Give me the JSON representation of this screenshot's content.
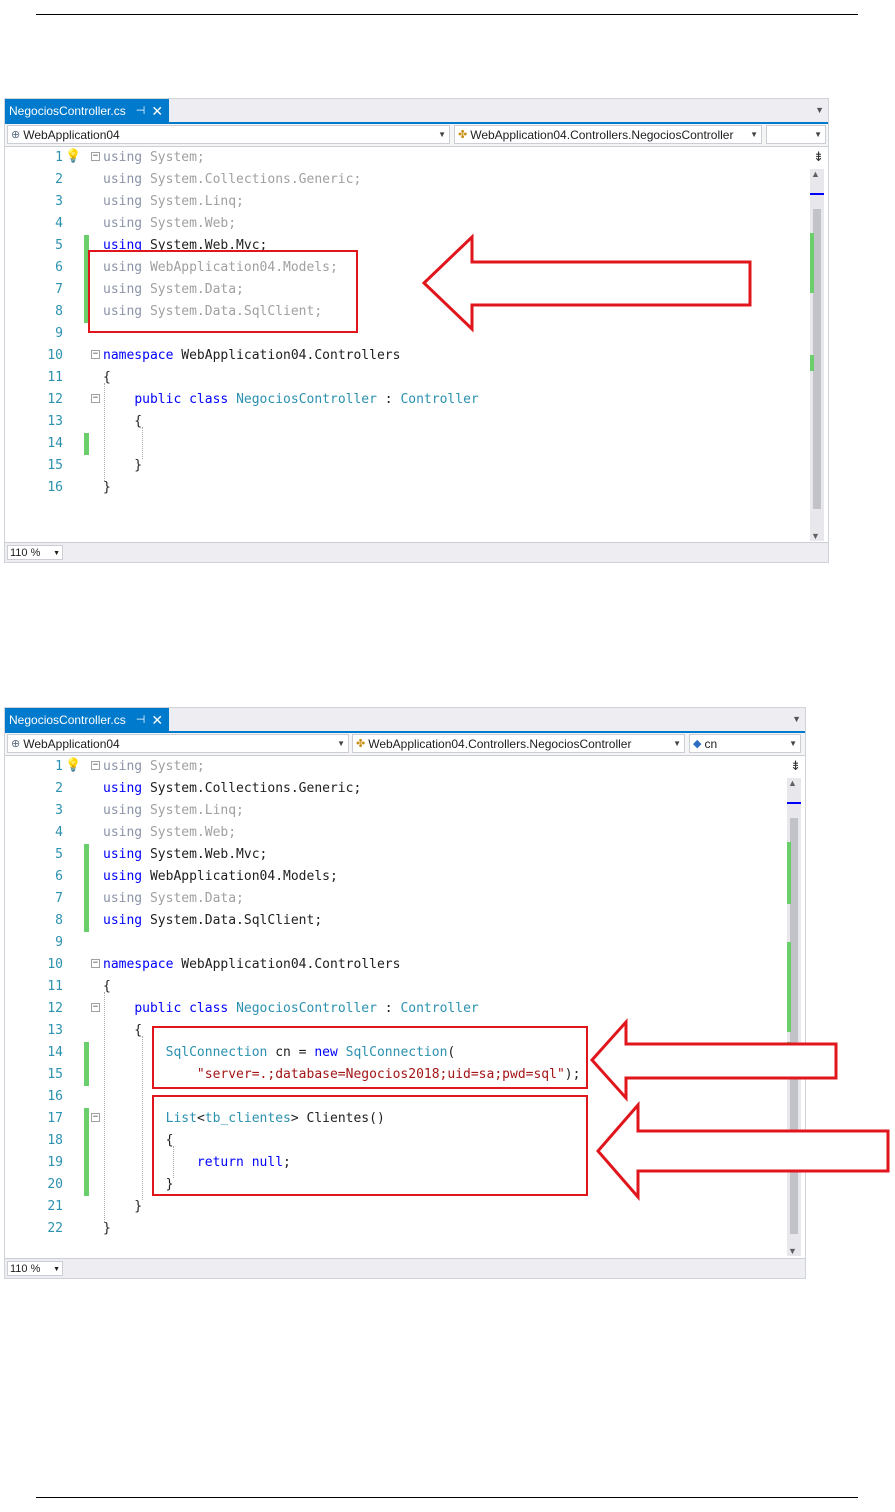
{
  "editor1": {
    "tab": {
      "filename": "NegociosController.cs",
      "pin": "⊣",
      "close": "✕"
    },
    "nav": {
      "project": "WebApplication04",
      "class": "WebApplication04.Controllers.NegociosController",
      "member": ""
    },
    "zoom": "110 %",
    "lines": [
      {
        "n": "1",
        "tokens": [
          [
            "kw dim",
            "using"
          ],
          [
            "dimns",
            " System;"
          ]
        ]
      },
      {
        "n": "2",
        "tokens": [
          [
            "kw dim",
            "using"
          ],
          [
            "dimns",
            " System.Collections.Generic;"
          ]
        ]
      },
      {
        "n": "3",
        "tokens": [
          [
            "kw dim",
            "using"
          ],
          [
            "dimns",
            " System.Linq;"
          ]
        ]
      },
      {
        "n": "4",
        "tokens": [
          [
            "kw dim",
            "using"
          ],
          [
            "dimns",
            " System.Web;"
          ]
        ]
      },
      {
        "n": "5",
        "tokens": [
          [
            "kw",
            "using"
          ],
          [
            "",
            " System.Web.Mvc;"
          ]
        ]
      },
      {
        "n": "6",
        "tokens": [
          [
            "kw dim",
            "using"
          ],
          [
            "dimns",
            " WebApplication04.Models;"
          ]
        ]
      },
      {
        "n": "7",
        "tokens": [
          [
            "kw dim",
            "using"
          ],
          [
            "dimns",
            " System.Data;"
          ]
        ]
      },
      {
        "n": "8",
        "tokens": [
          [
            "kw dim",
            "using"
          ],
          [
            "dimns",
            " System.Data.SqlClient;"
          ]
        ]
      },
      {
        "n": "9",
        "tokens": []
      },
      {
        "n": "10",
        "tokens": [
          [
            "kw",
            "namespace"
          ],
          [
            "",
            " WebApplication04.Controllers"
          ]
        ]
      },
      {
        "n": "11",
        "tokens": [
          [
            "",
            "{"
          ]
        ]
      },
      {
        "n": "12",
        "tokens": [
          [
            "",
            "    "
          ],
          [
            "kw",
            "public"
          ],
          [
            "",
            " "
          ],
          [
            "kw",
            "class"
          ],
          [
            "",
            " "
          ],
          [
            "typ",
            "NegociosController"
          ],
          [
            "",
            " : "
          ],
          [
            "typ",
            "Controller"
          ]
        ]
      },
      {
        "n": "13",
        "tokens": [
          [
            "",
            "    {"
          ]
        ]
      },
      {
        "n": "14",
        "tokens": []
      },
      {
        "n": "15",
        "tokens": [
          [
            "",
            "    }"
          ]
        ]
      },
      {
        "n": "16",
        "tokens": [
          [
            "",
            "}"
          ]
        ]
      }
    ]
  },
  "editor2": {
    "tab": {
      "filename": "NegociosController.cs",
      "pin": "⊣",
      "close": "✕"
    },
    "nav": {
      "project": "WebApplication04",
      "class": "WebApplication04.Controllers.NegociosController",
      "member": "cn"
    },
    "zoom": "110 %",
    "lines": [
      {
        "n": "1",
        "tokens": [
          [
            "kw dim",
            "using"
          ],
          [
            "dimns",
            " System;"
          ]
        ]
      },
      {
        "n": "2",
        "tokens": [
          [
            "kw",
            "using"
          ],
          [
            "",
            " System.Collections.Generic;"
          ]
        ]
      },
      {
        "n": "3",
        "tokens": [
          [
            "kw dim",
            "using"
          ],
          [
            "dimns",
            " System.Linq;"
          ]
        ]
      },
      {
        "n": "4",
        "tokens": [
          [
            "kw dim",
            "using"
          ],
          [
            "dimns",
            " System.Web;"
          ]
        ]
      },
      {
        "n": "5",
        "tokens": [
          [
            "kw",
            "using"
          ],
          [
            "",
            " System.Web.Mvc;"
          ]
        ]
      },
      {
        "n": "6",
        "tokens": [
          [
            "kw",
            "using"
          ],
          [
            "",
            " WebApplication04.Models;"
          ]
        ]
      },
      {
        "n": "7",
        "tokens": [
          [
            "kw dim",
            "using"
          ],
          [
            "dimns",
            " System.Data;"
          ]
        ]
      },
      {
        "n": "8",
        "tokens": [
          [
            "kw",
            "using"
          ],
          [
            "",
            " System.Data.SqlClient;"
          ]
        ]
      },
      {
        "n": "9",
        "tokens": []
      },
      {
        "n": "10",
        "tokens": [
          [
            "kw",
            "namespace"
          ],
          [
            "",
            " WebApplication04.Controllers"
          ]
        ]
      },
      {
        "n": "11",
        "tokens": [
          [
            "",
            "{"
          ]
        ]
      },
      {
        "n": "12",
        "tokens": [
          [
            "",
            "    "
          ],
          [
            "kw",
            "public"
          ],
          [
            "",
            " "
          ],
          [
            "kw",
            "class"
          ],
          [
            "",
            " "
          ],
          [
            "typ",
            "NegociosController"
          ],
          [
            "",
            " : "
          ],
          [
            "typ",
            "Controller"
          ]
        ]
      },
      {
        "n": "13",
        "tokens": [
          [
            "",
            "    {"
          ]
        ]
      },
      {
        "n": "14",
        "tokens": [
          [
            "",
            "        "
          ],
          [
            "typ",
            "SqlConnection"
          ],
          [
            "",
            " cn = "
          ],
          [
            "kw",
            "new"
          ],
          [
            "",
            " "
          ],
          [
            "typ",
            "SqlConnection"
          ],
          [
            "",
            "("
          ]
        ]
      },
      {
        "n": "15",
        "tokens": [
          [
            "",
            "            "
          ],
          [
            "str",
            "\"server=.;database=Negocios2018;uid=sa;pwd=sql\""
          ],
          [
            "",
            ");"
          ]
        ]
      },
      {
        "n": "16",
        "tokens": []
      },
      {
        "n": "17",
        "tokens": [
          [
            "",
            "        "
          ],
          [
            "typ",
            "List"
          ],
          [
            "",
            "<"
          ],
          [
            "typ",
            "tb_clientes"
          ],
          [
            "",
            "> Clientes()"
          ]
        ]
      },
      {
        "n": "18",
        "tokens": [
          [
            "",
            "        {"
          ]
        ]
      },
      {
        "n": "19",
        "tokens": [
          [
            "",
            "            "
          ],
          [
            "kw",
            "return"
          ],
          [
            "",
            " "
          ],
          [
            "kw",
            "null"
          ],
          [
            "",
            ";"
          ]
        ]
      },
      {
        "n": "20",
        "tokens": [
          [
            "",
            "        }"
          ]
        ]
      },
      {
        "n": "21",
        "tokens": [
          [
            "",
            "    }"
          ]
        ]
      },
      {
        "n": "22",
        "tokens": [
          [
            "",
            "}"
          ]
        ]
      }
    ]
  },
  "colors": {
    "accent": "#007acc",
    "highlight": "#e0161c",
    "change_bar": "#6ace6a",
    "keyword": "#0000ff",
    "type": "#2b91af",
    "string": "#a31515"
  },
  "icons": [
    "lightbulb-icon",
    "pin-icon",
    "close-icon",
    "project-globe-icon",
    "class-icon",
    "field-icon",
    "splitter-icon"
  ]
}
